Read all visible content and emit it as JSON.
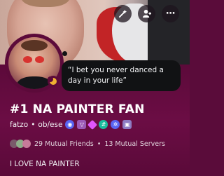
{
  "profile": {
    "display_name": "#1 NA PAINTER FAN",
    "username": "fatzo",
    "pronouns": "ob/ese",
    "separator": "•",
    "custom_status": "“I bet you never danced a day in your life”",
    "mutual_friends": "29 Mutual Friends",
    "mutual_servers": "13 Mutual Servers",
    "mutual_separator": "•",
    "bio": "I LOVE NA PAINTER",
    "status": "idle"
  },
  "top_buttons": [
    {
      "name": "wand-icon"
    },
    {
      "name": "add-friend-icon"
    },
    {
      "name": "more-icon",
      "glyph": "⋯"
    }
  ],
  "badges": [
    {
      "name": "hypesquad-badge",
      "color": "#5865f2"
    },
    {
      "name": "nitro-badge",
      "color": "#9b59b6"
    },
    {
      "name": "boost-badge",
      "color": "#e056fd"
    },
    {
      "name": "hash-badge",
      "color": "#1abc9c"
    },
    {
      "name": "quest-badge",
      "color": "#5865f2"
    },
    {
      "name": "gift-badge",
      "color": "#8e7cc3"
    }
  ],
  "colors": {
    "profile_bg": "#5c0a3a",
    "text": "#f2f3f5",
    "idle": "#f0b232"
  }
}
